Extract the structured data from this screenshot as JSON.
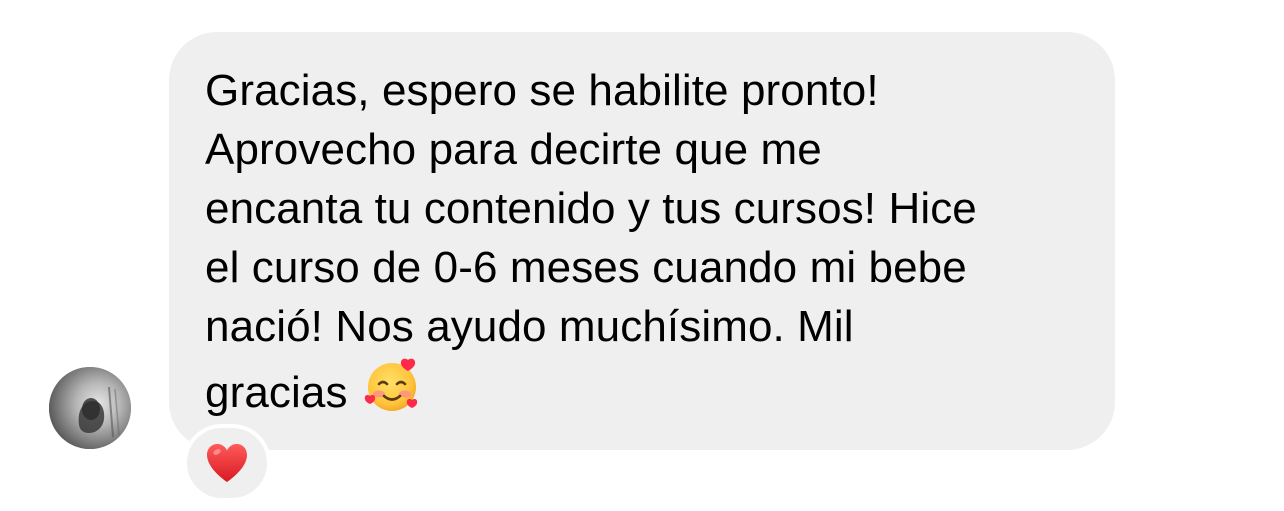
{
  "message": {
    "lines": [
      "Gracias, espero se habilite pronto!",
      "Aprovecho para decirte que me",
      "encanta tu contenido y tus cursos! Hice",
      "el curso de 0-6 meses cuando mi bebe",
      "nació! Nos ayudo muchísimo. Mil",
      "gracias"
    ],
    "trailing_emoji": "smiling-face-with-hearts-icon"
  },
  "reaction": {
    "emoji": "red-heart-icon"
  },
  "colors": {
    "bubble_background": "#efefef",
    "text": "#000000",
    "heart": "#e0272c",
    "page_background": "#ffffff"
  }
}
